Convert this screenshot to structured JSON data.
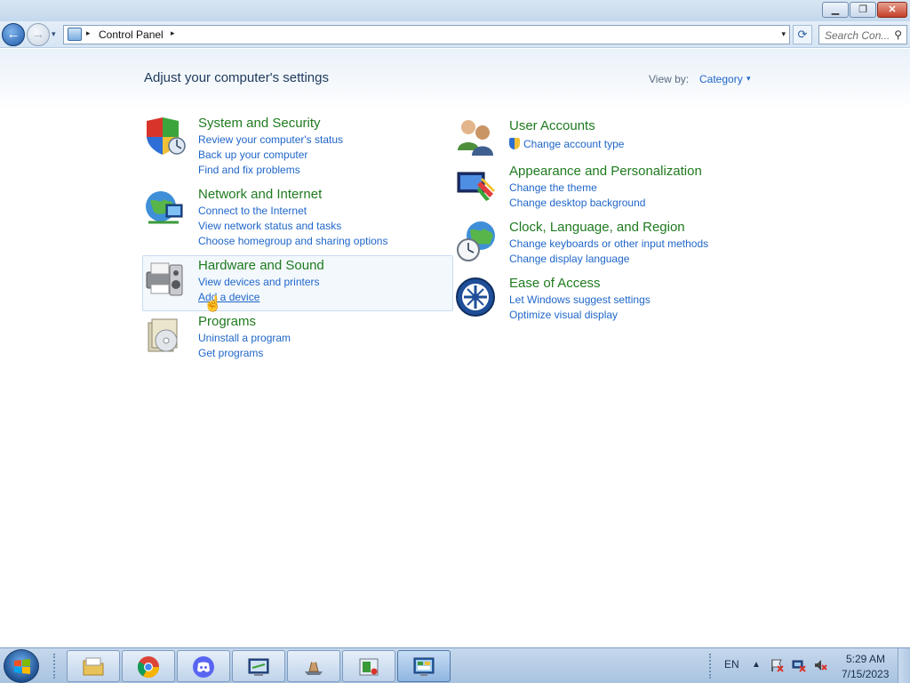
{
  "window": {
    "minimize_glyph": "▁",
    "maximize_glyph": "❐",
    "close_glyph": "✕"
  },
  "navigation": {
    "back_glyph": "←",
    "forward_glyph": "→",
    "recent_glyph": "▾",
    "breadcrumb_sep": "▸",
    "address": "Control Panel",
    "address_dropdown_glyph": "▾",
    "refresh_glyph": "⟳",
    "search_placeholder": "Search Con...",
    "search_glyph": "⚲"
  },
  "main": {
    "heading": "Adjust your computer's settings",
    "view_by_label": "View by:",
    "view_by_value": "Category",
    "view_by_caret": "▾",
    "categories_left": [
      {
        "title": "System and Security",
        "icon": "shield-icon",
        "links": [
          "Review your computer's status",
          "Back up your computer",
          "Find and fix problems"
        ]
      },
      {
        "title": "Network and Internet",
        "icon": "network-globe-icon",
        "links": [
          "Connect to the Internet",
          "View network status and tasks",
          "Choose homegroup and sharing options"
        ]
      },
      {
        "title": "Hardware and Sound",
        "icon": "printer-speaker-icon",
        "links": [
          "View devices and printers",
          "Add a device"
        ]
      },
      {
        "title": "Programs",
        "icon": "programs-disc-icon",
        "links": [
          "Uninstall a program",
          "Get programs"
        ]
      }
    ],
    "categories_right": [
      {
        "title": "User Accounts",
        "icon": "users-icon",
        "links": [
          "Change account type"
        ]
      },
      {
        "title": "Appearance and Personalization",
        "icon": "monitor-palette-icon",
        "links": [
          "Change the theme",
          "Change desktop background"
        ]
      },
      {
        "title": "Clock, Language, and Region",
        "icon": "globe-clock-icon",
        "links": [
          "Change keyboards or other input methods",
          "Change display language"
        ]
      },
      {
        "title": "Ease of Access",
        "icon": "ease-of-access-icon",
        "links": [
          "Let Windows suggest settings",
          "Optimize visual display"
        ]
      }
    ]
  },
  "taskbar": {
    "items": [
      "file-explorer-icon",
      "chrome-icon",
      "discord-icon",
      "display-settings-icon",
      "app-icon",
      "media-icon",
      "control-panel-icon"
    ],
    "language": "EN",
    "tray_arrow": "▲",
    "time": "5:29 AM",
    "date": "7/15/2023"
  },
  "colors": {
    "category_title": "#1f7a1f",
    "link": "#1f66c9",
    "heading": "#1e395b"
  }
}
